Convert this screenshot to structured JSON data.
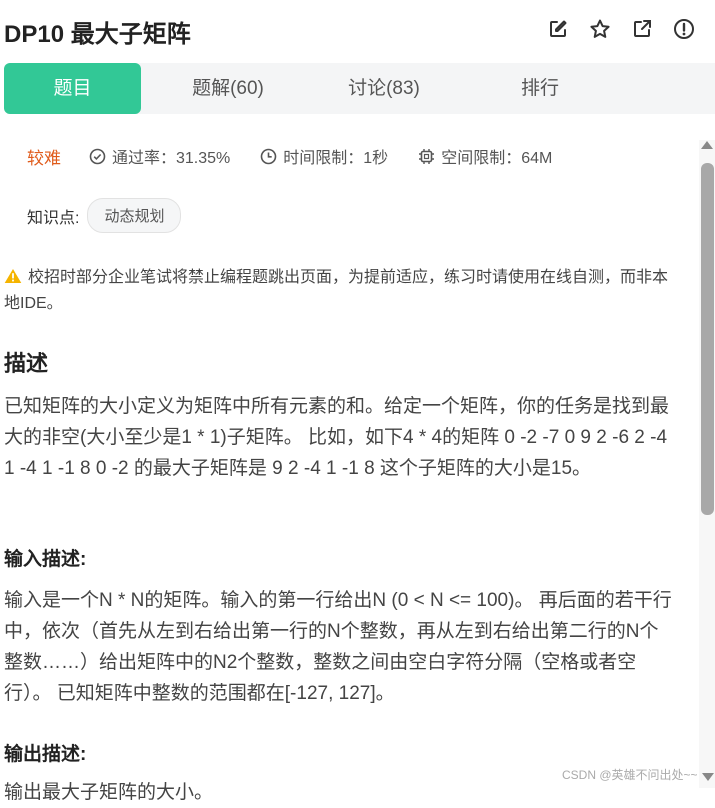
{
  "header": {
    "title": "DP10  最大子矩阵",
    "icons": [
      "edit-icon",
      "star-icon",
      "share-icon",
      "report-icon"
    ]
  },
  "tabs": [
    {
      "label": "题目",
      "active": true
    },
    {
      "label": "题解(60)",
      "active": false
    },
    {
      "label": "讨论(83)",
      "active": false
    },
    {
      "label": "排行",
      "active": false
    }
  ],
  "meta": {
    "difficulty": "较难",
    "pass_rate": "通过率：31.35%",
    "time_limit": "时间限制：1秒",
    "space_limit": "空间限制：64M"
  },
  "knowledge": {
    "label": "知识点:",
    "tag": "动态规划"
  },
  "warning": "校招时部分企业笔试将禁止编程题跳出页面，为提前适应，练习时请使用在线自测，而非本地IDE。",
  "description": {
    "heading": "描述",
    "text": "已知矩阵的大小定义为矩阵中所有元素的和。给定一个矩阵，你的任务是找到最大的非空(大小至少是1 * 1)子矩阵。 比如，如下4 * 4的矩阵 0 -2 -7 0 9 2 -6 2 -4 1 -4 1 -1 8 0 -2 的最大子矩阵是 9 2 -4 1 -1 8 这个子矩阵的大小是15。"
  },
  "input": {
    "heading": "输入描述:",
    "text": "输入是一个N * N的矩阵。输入的第一行给出N (0 < N <= 100)。 再后面的若干行中，依次（首先从左到右给出第一行的N个整数，再从左到右给出第二行的N个整数……）给出矩阵中的N2个整数，整数之间由空白字符分隔（空格或者空行）。 已知矩阵中整数的范围都在[-127, 127]。"
  },
  "output": {
    "heading": "输出描述:",
    "text": "输出最大子矩阵的大小。"
  },
  "watermark": "CSDN @英雄不问出处~~",
  "colors": {
    "accent": "#32c896",
    "difficulty": "#e05b1b",
    "warning": "#f5b400"
  }
}
